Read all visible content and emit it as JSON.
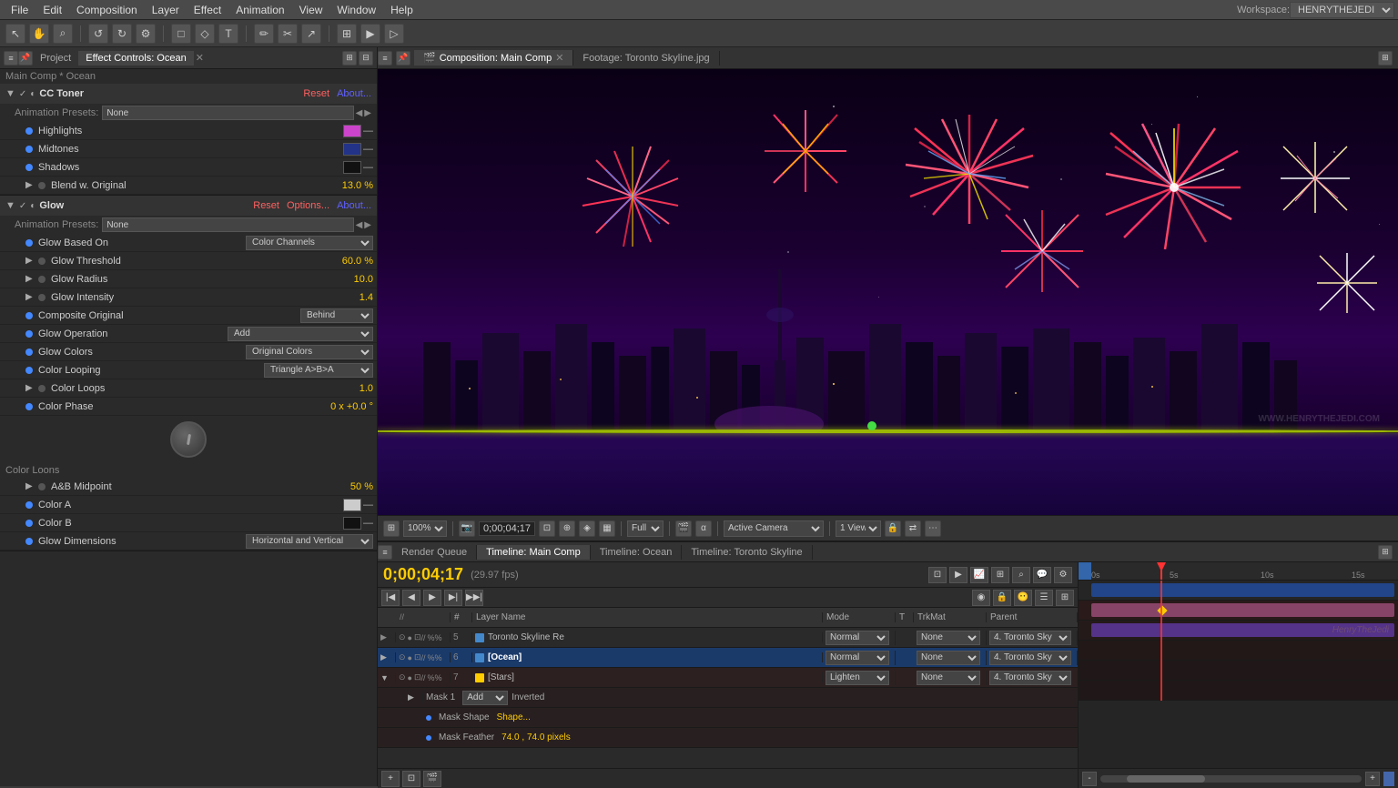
{
  "menuBar": {
    "items": [
      "File",
      "Edit",
      "Composition",
      "Layer",
      "Effect",
      "Animation",
      "View",
      "Window",
      "Help"
    ]
  },
  "toolbar": {
    "tools": [
      "↖",
      "✋",
      "🔍",
      "↺",
      "↻",
      "⚙",
      "□",
      "◇",
      "T",
      "✏",
      "✂",
      "↗"
    ],
    "workspace_label": "Workspace:",
    "workspace_value": "HENRYTHEJEDI"
  },
  "leftPanel": {
    "tabs": [
      "Project",
      "Effect Controls: Ocean"
    ],
    "title": "Main Comp * Ocean",
    "effects": [
      {
        "name": "CC Toner",
        "reset": "Reset",
        "about": "About...",
        "animPresets": "None",
        "params": [
          {
            "name": "Highlights",
            "color": "#cc44cc",
            "hasDash": true
          },
          {
            "name": "Midtones",
            "color": "#223388",
            "hasDash": true
          },
          {
            "name": "Shadows",
            "color": "#111111",
            "hasDash": true
          },
          {
            "name": "Blend w. Original",
            "value": "13.0 %"
          }
        ]
      },
      {
        "name": "Glow",
        "reset": "Reset",
        "options": "Options...",
        "about": "About...",
        "animPresets": "None",
        "params": [
          {
            "name": "Glow Based On",
            "selectVal": "Color Channels"
          },
          {
            "name": "Glow Threshold",
            "value": "60.0 %"
          },
          {
            "name": "Glow Radius",
            "value": "10.0"
          },
          {
            "name": "Glow Intensity",
            "value": "1.4"
          },
          {
            "name": "Composite Original",
            "selectVal": "Behind"
          },
          {
            "name": "Glow Operation",
            "selectVal": "Add"
          },
          {
            "name": "Glow Colors",
            "selectVal": "Original Colors"
          },
          {
            "name": "Color Looping",
            "selectVal": "Triangle A>B>A"
          },
          {
            "name": "Color Loops",
            "value": "1.0"
          },
          {
            "name": "Color Phase",
            "value": "0 x +0.0 °"
          },
          {
            "name": "A&B Midpoint",
            "value": "50 %"
          },
          {
            "name": "Color A",
            "color": "#cccccc",
            "hasDash": true
          },
          {
            "name": "Color B",
            "color": "#111111",
            "hasDash": true
          },
          {
            "name": "Glow Dimensions",
            "selectVal": "Horizontal and Vertical"
          }
        ]
      }
    ]
  },
  "viewer": {
    "tabs": [
      "Composition: Main Comp",
      "Footage: Toronto Skyline.jpg"
    ],
    "controls": {
      "zoom": "100%",
      "timecode": "0;00;04;17",
      "quality": "Full",
      "camera": "Active Camera",
      "view": "1 View"
    }
  },
  "bottomPanel": {
    "tabs": [
      "Render Queue",
      "Timeline: Main Comp",
      "Timeline: Ocean",
      "Timeline: Toronto Skyline"
    ],
    "activeTab": "Timeline: Main Comp",
    "timecode": "0;00;04;17",
    "fps": "(29.97 fps)",
    "columns": [
      "",
      "",
      "",
      "Layer Name",
      "Mode",
      "T",
      "TrkMat",
      "Parent"
    ],
    "layers": [
      {
        "num": "5",
        "color": "#4488cc",
        "name": "Toronto Skyline Re",
        "mode": "Normal",
        "trkmat": "None",
        "parent": "4. Toronto Sky",
        "expanded": false
      },
      {
        "num": "6",
        "color": "#4488cc",
        "name": "[Ocean]",
        "mode": "Normal",
        "trkmat": "None",
        "parent": "4. Toronto Sky",
        "expanded": false,
        "selected": true
      },
      {
        "num": "7",
        "color": "#ffcc00",
        "name": "[Stars]",
        "mode": "Lighten",
        "trkmat": "None",
        "parent": "4. Toronto Sky",
        "expanded": true,
        "subItems": [
          {
            "name": "Mask 1",
            "extra": "Add",
            "extraB": "Inverted"
          },
          {
            "name": "Mask Shape",
            "value": "Shape..."
          },
          {
            "name": "Mask Feather",
            "value": "74.0 , 74.0 pixels"
          }
        ]
      }
    ]
  }
}
